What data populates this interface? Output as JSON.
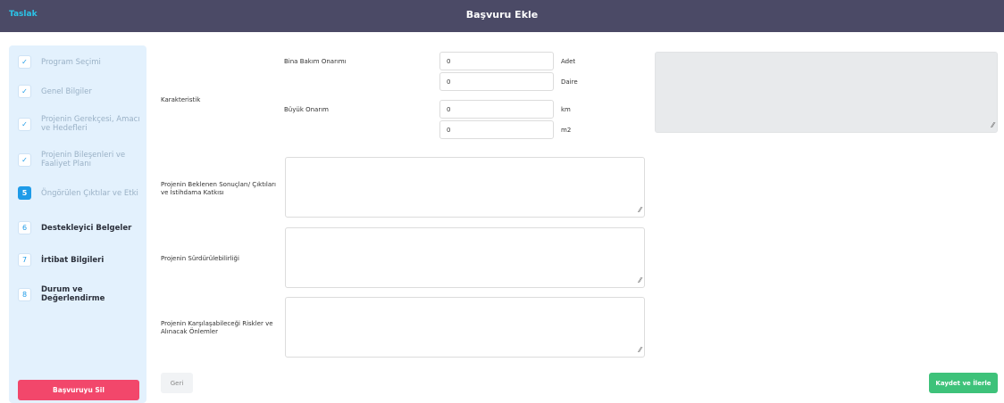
{
  "header": {
    "status": "Taslak",
    "title": "Başvuru Ekle"
  },
  "sidebar": {
    "steps": [
      {
        "badge": "✓",
        "label": "Program Seçimi",
        "state": "done"
      },
      {
        "badge": "✓",
        "label": "Genel Bilgiler",
        "state": "done"
      },
      {
        "badge": "✓",
        "label": "Projenin Gerekçesi, Amacı ve Hedefleri",
        "state": "done"
      },
      {
        "badge": "✓",
        "label": "Projenin Bileşenleri ve Faaliyet Planı",
        "state": "done"
      },
      {
        "badge": "5",
        "label": "Öngörülen Çıktılar ve Etki",
        "state": "active"
      },
      {
        "badge": "6",
        "label": "Destekleyici Belgeler",
        "state": "todo"
      },
      {
        "badge": "7",
        "label": "İrtibat Bilgileri",
        "state": "todo"
      },
      {
        "badge": "8",
        "label": "Durum ve Değerlendirme",
        "state": "todo"
      }
    ],
    "delete_label": "Başvuruyu Sil"
  },
  "form": {
    "karakteristik_label": "Karakteristik",
    "bina_label": "Bina Bakım Onarımı",
    "bina_adet_value": "0",
    "bina_adet_unit": "Adet",
    "bina_daire_value": "0",
    "bina_daire_unit": "Daire",
    "buyuk_label": "Büyük Onarım",
    "buyuk_km_value": "0",
    "buyuk_km_unit": "km",
    "buyuk_m2_value": "0",
    "buyuk_m2_unit": "m2",
    "sonuclar_label": "Projenin Beklenen Sonuçları/ Çıktıları ve İstihdama Katkısı",
    "surdurulebilirlik_label": "Projenin Sürdürülebilirliği",
    "riskler_label": "Projenin Karşılaşabileceği Riskler ve Alınacak Önlemler"
  },
  "footer": {
    "back_label": "Geri",
    "save_label": "Kaydet ve İlerle"
  },
  "colors": {
    "header_bg": "#4b4a66",
    "status_accent": "#2bc4e8",
    "sidebar_bg": "#e3f1fd",
    "step_active": "#1e9be8",
    "delete": "#f2476b",
    "save": "#3ec27a"
  }
}
